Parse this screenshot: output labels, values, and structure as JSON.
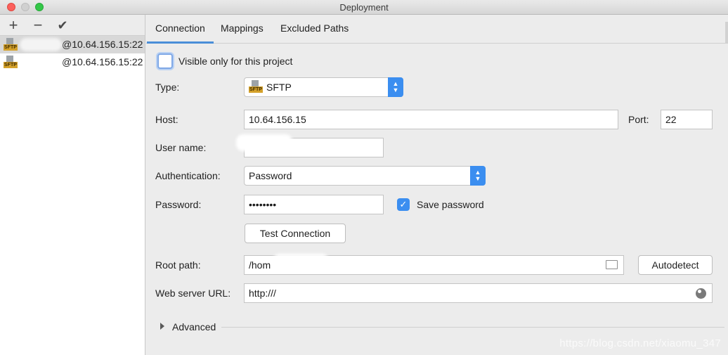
{
  "window": {
    "title": "Deployment"
  },
  "left_panel": {
    "servers": [
      {
        "label": "@10.64.156.15:22",
        "icon_tag": "SFTP",
        "selected": true
      },
      {
        "label": "@10.64.156.15:22",
        "icon_tag": "SFTP",
        "selected": false
      }
    ]
  },
  "tabs": [
    {
      "label": "Connection",
      "active": true
    },
    {
      "label": "Mappings",
      "active": false
    },
    {
      "label": "Excluded Paths",
      "active": false
    }
  ],
  "connection": {
    "visible_only_label": "Visible only for this project",
    "visible_only_checked": false,
    "type_label": "Type:",
    "type_value": "SFTP",
    "type_icon_tag": "SFTP",
    "host_label": "Host:",
    "host_value": "10.64.156.15",
    "port_label": "Port:",
    "port_value": "22",
    "username_label": "User name:",
    "username_value": "",
    "auth_label": "Authentication:",
    "auth_value": "Password",
    "password_label": "Password:",
    "password_value": "••••••••",
    "save_password_label": "Save password",
    "save_password_checked": true,
    "test_connection_label": "Test Connection",
    "root_path_label": "Root path:",
    "root_path_value": "/hom",
    "autodetect_label": "Autodetect",
    "web_url_label": "Web server URL:",
    "web_url_value": "http:///",
    "advanced_label": "Advanced"
  },
  "watermark": "https://blog.csdn.net/xiaomu_347",
  "colors": {
    "accent": "#3b8ef0",
    "tab_underline": "#4a8ed8",
    "sftp_tag": "#d4a12a"
  },
  "icons": [
    "add-icon",
    "remove-icon",
    "check-icon",
    "sftp-icon",
    "chevron-updown-icon",
    "folder-icon",
    "globe-icon",
    "triangle-right-icon"
  ]
}
